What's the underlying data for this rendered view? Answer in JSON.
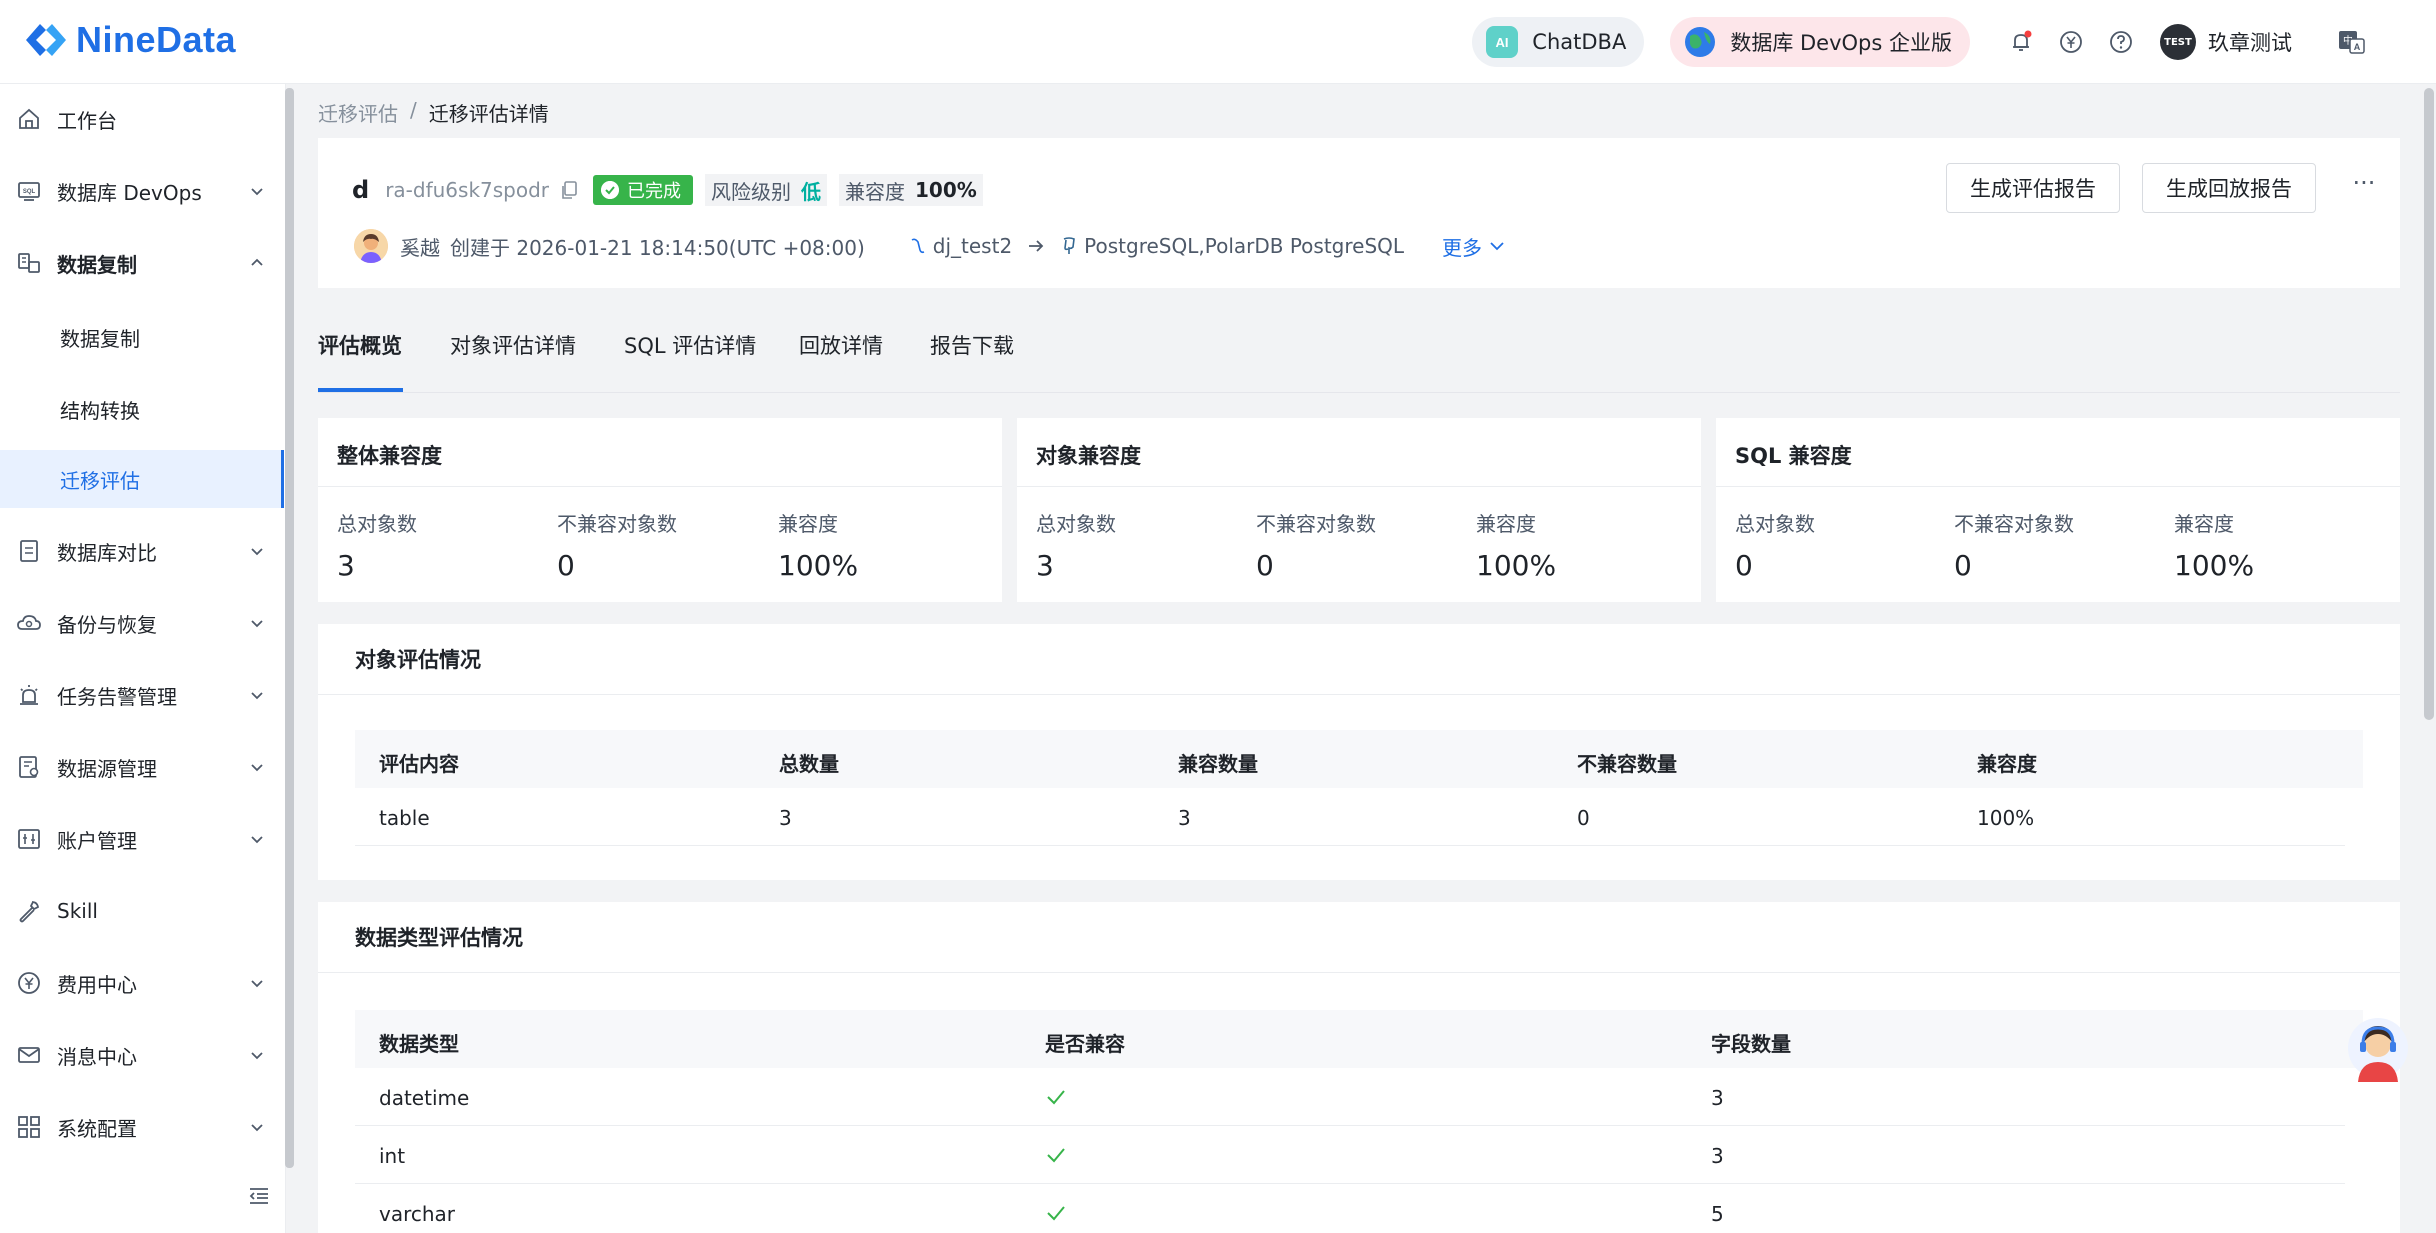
{
  "app": {
    "logo_text": "NineData"
  },
  "topbar": {
    "chat_label": "ChatDBA",
    "devops_label": "数据库 DevOps 企业版",
    "user_avatar_text": "TEST",
    "user_name": "玖章测试"
  },
  "sidebar": {
    "items": [
      {
        "label": "工作台",
        "icon": "home-icon"
      },
      {
        "label": "数据库 DevOps",
        "icon": "sql-icon"
      },
      {
        "label": "数据复制",
        "icon": "replication-icon"
      },
      {
        "label": "数据库对比",
        "icon": "compare-icon"
      },
      {
        "label": "备份与恢复",
        "icon": "cloud-backup-icon"
      },
      {
        "label": "任务告警管理",
        "icon": "alarm-icon"
      },
      {
        "label": "数据源管理",
        "icon": "datasource-icon"
      },
      {
        "label": "账户管理",
        "icon": "account-icon"
      },
      {
        "label": "Skill",
        "icon": "wrench-icon"
      },
      {
        "label": "费用中心",
        "icon": "yen-icon"
      },
      {
        "label": "消息中心",
        "icon": "mail-icon"
      },
      {
        "label": "系统配置",
        "icon": "grid-icon"
      }
    ],
    "sub_items": [
      "数据复制",
      "结构转换",
      "迁移评估"
    ]
  },
  "breadcrumb": {
    "parent": "迁移评估",
    "separator": "/",
    "current": "迁移评估详情"
  },
  "task": {
    "name": "d",
    "id": "ra-dfu6sk7spodr",
    "status": "已完成",
    "risk_label": "风险级别",
    "risk_value": "低",
    "compat_label": "兼容度",
    "compat_value": "100%",
    "creator": "奚越",
    "created_text": "创建于 2026-01-21 18:14:50(UTC +08:00)",
    "source": "dj_test2",
    "target": "PostgreSQL,PolarDB PostgreSQL",
    "more_label": "更多",
    "btn_report": "生成评估报告",
    "btn_replay_report": "生成回放报告",
    "more_dots": "···"
  },
  "tabs": [
    "评估概览",
    "对象评估详情",
    "SQL 评估详情",
    "回放详情",
    "报告下载"
  ],
  "summary": [
    {
      "title": "整体兼容度",
      "labels": [
        "总对象数",
        "不兼容对象数",
        "兼容度"
      ],
      "values": [
        "3",
        "0",
        "100%"
      ]
    },
    {
      "title": "对象兼容度",
      "labels": [
        "总对象数",
        "不兼容对象数",
        "兼容度"
      ],
      "values": [
        "3",
        "0",
        "100%"
      ]
    },
    {
      "title": "SQL 兼容度",
      "labels": [
        "总对象数",
        "不兼容对象数",
        "兼容度"
      ],
      "values": [
        "0",
        "0",
        "100%"
      ]
    }
  ],
  "object_eval": {
    "title": "对象评估情况",
    "columns": [
      "评估内容",
      "总数量",
      "兼容数量",
      "不兼容数量",
      "兼容度"
    ],
    "rows": [
      [
        "table",
        "3",
        "3",
        "0",
        "100%"
      ]
    ]
  },
  "datatype_eval": {
    "title": "数据类型评估情况",
    "columns": [
      "数据类型",
      "是否兼容",
      "字段数量"
    ],
    "rows": [
      {
        "type": "datetime",
        "compatible": true,
        "count": "3"
      },
      {
        "type": "int",
        "compatible": true,
        "count": "3"
      },
      {
        "type": "varchar",
        "compatible": true,
        "count": "5"
      }
    ]
  },
  "colors": {
    "accent": "#1f6fe5",
    "success": "#37b44a",
    "low_risk": "#00b0a0"
  }
}
